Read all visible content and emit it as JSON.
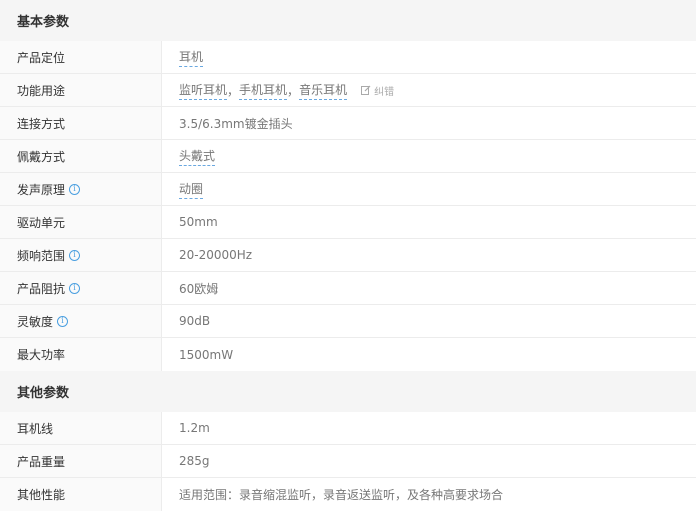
{
  "sections": [
    {
      "title": "基本参数",
      "rows": [
        {
          "label": "产品定位",
          "value": "耳机"
        },
        {
          "label": "功能用途",
          "values": [
            "监听耳机",
            "手机耳机",
            "音乐耳机"
          ],
          "separator": "，",
          "report_label": "纠错"
        },
        {
          "label": "连接方式",
          "value": "3.5/6.3mm镀金插头"
        },
        {
          "label": "佩戴方式",
          "value": "头戴式"
        },
        {
          "label": "发声原理",
          "value": "动圈"
        },
        {
          "label": "驱动单元",
          "value": "50mm"
        },
        {
          "label": "频响范围",
          "value": "20-20000Hz"
        },
        {
          "label": "产品阻抗",
          "value": "60欧姆"
        },
        {
          "label": "灵敏度",
          "value": "90dB"
        },
        {
          "label": "最大功率",
          "value": "1500mW"
        }
      ]
    },
    {
      "title": "其他参数",
      "rows": [
        {
          "label": "耳机线",
          "value": "1.2m"
        },
        {
          "label": "产品重量",
          "value": "285g"
        },
        {
          "label": "其他性能",
          "value": "适用范围：录音缩混监听，录音返送监听，及各种高要求场合"
        }
      ]
    }
  ],
  "icons": {
    "info": "info-circle-icon",
    "report": "edit-icon"
  },
  "colors": {
    "info_icon": "#4a9fe0",
    "dotted_underline": "#6aa8e0"
  }
}
